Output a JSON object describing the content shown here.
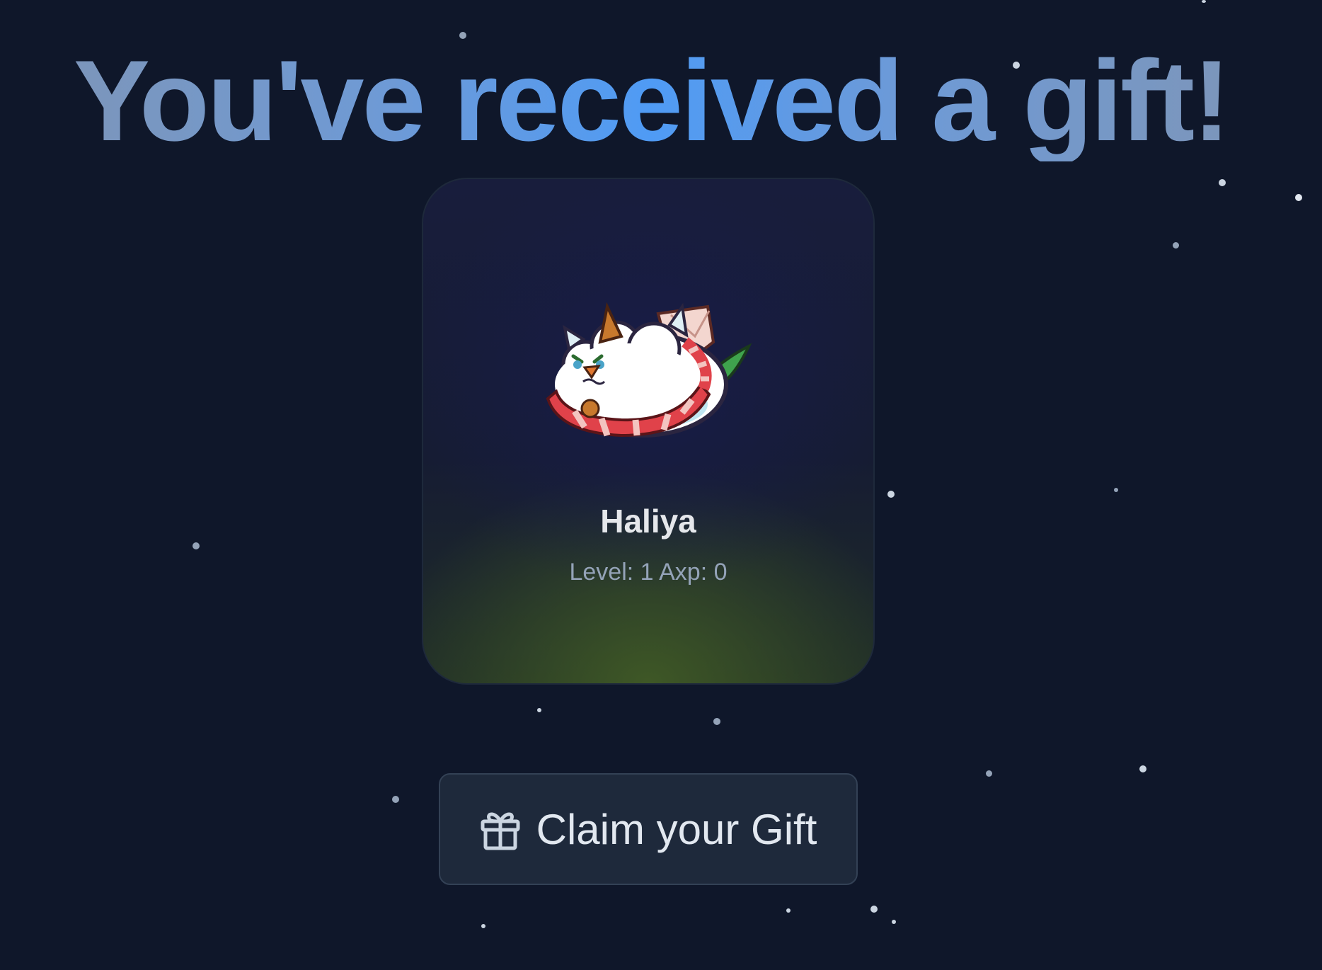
{
  "header": {
    "title": "You've received a gift!"
  },
  "gift_card": {
    "axie_name": "Haliya",
    "stats": "Level: 1 Axp: 0",
    "image_icon": "axie-creature-illustration"
  },
  "claim_button": {
    "label": "Claim your Gift",
    "icon": "gift-icon"
  },
  "colors": {
    "background": "#0f172a",
    "card_border": "#1e293b",
    "button_bg": "#1e293b",
    "title_accent": "#4f9bf5",
    "title_muted": "#7f95b5"
  }
}
